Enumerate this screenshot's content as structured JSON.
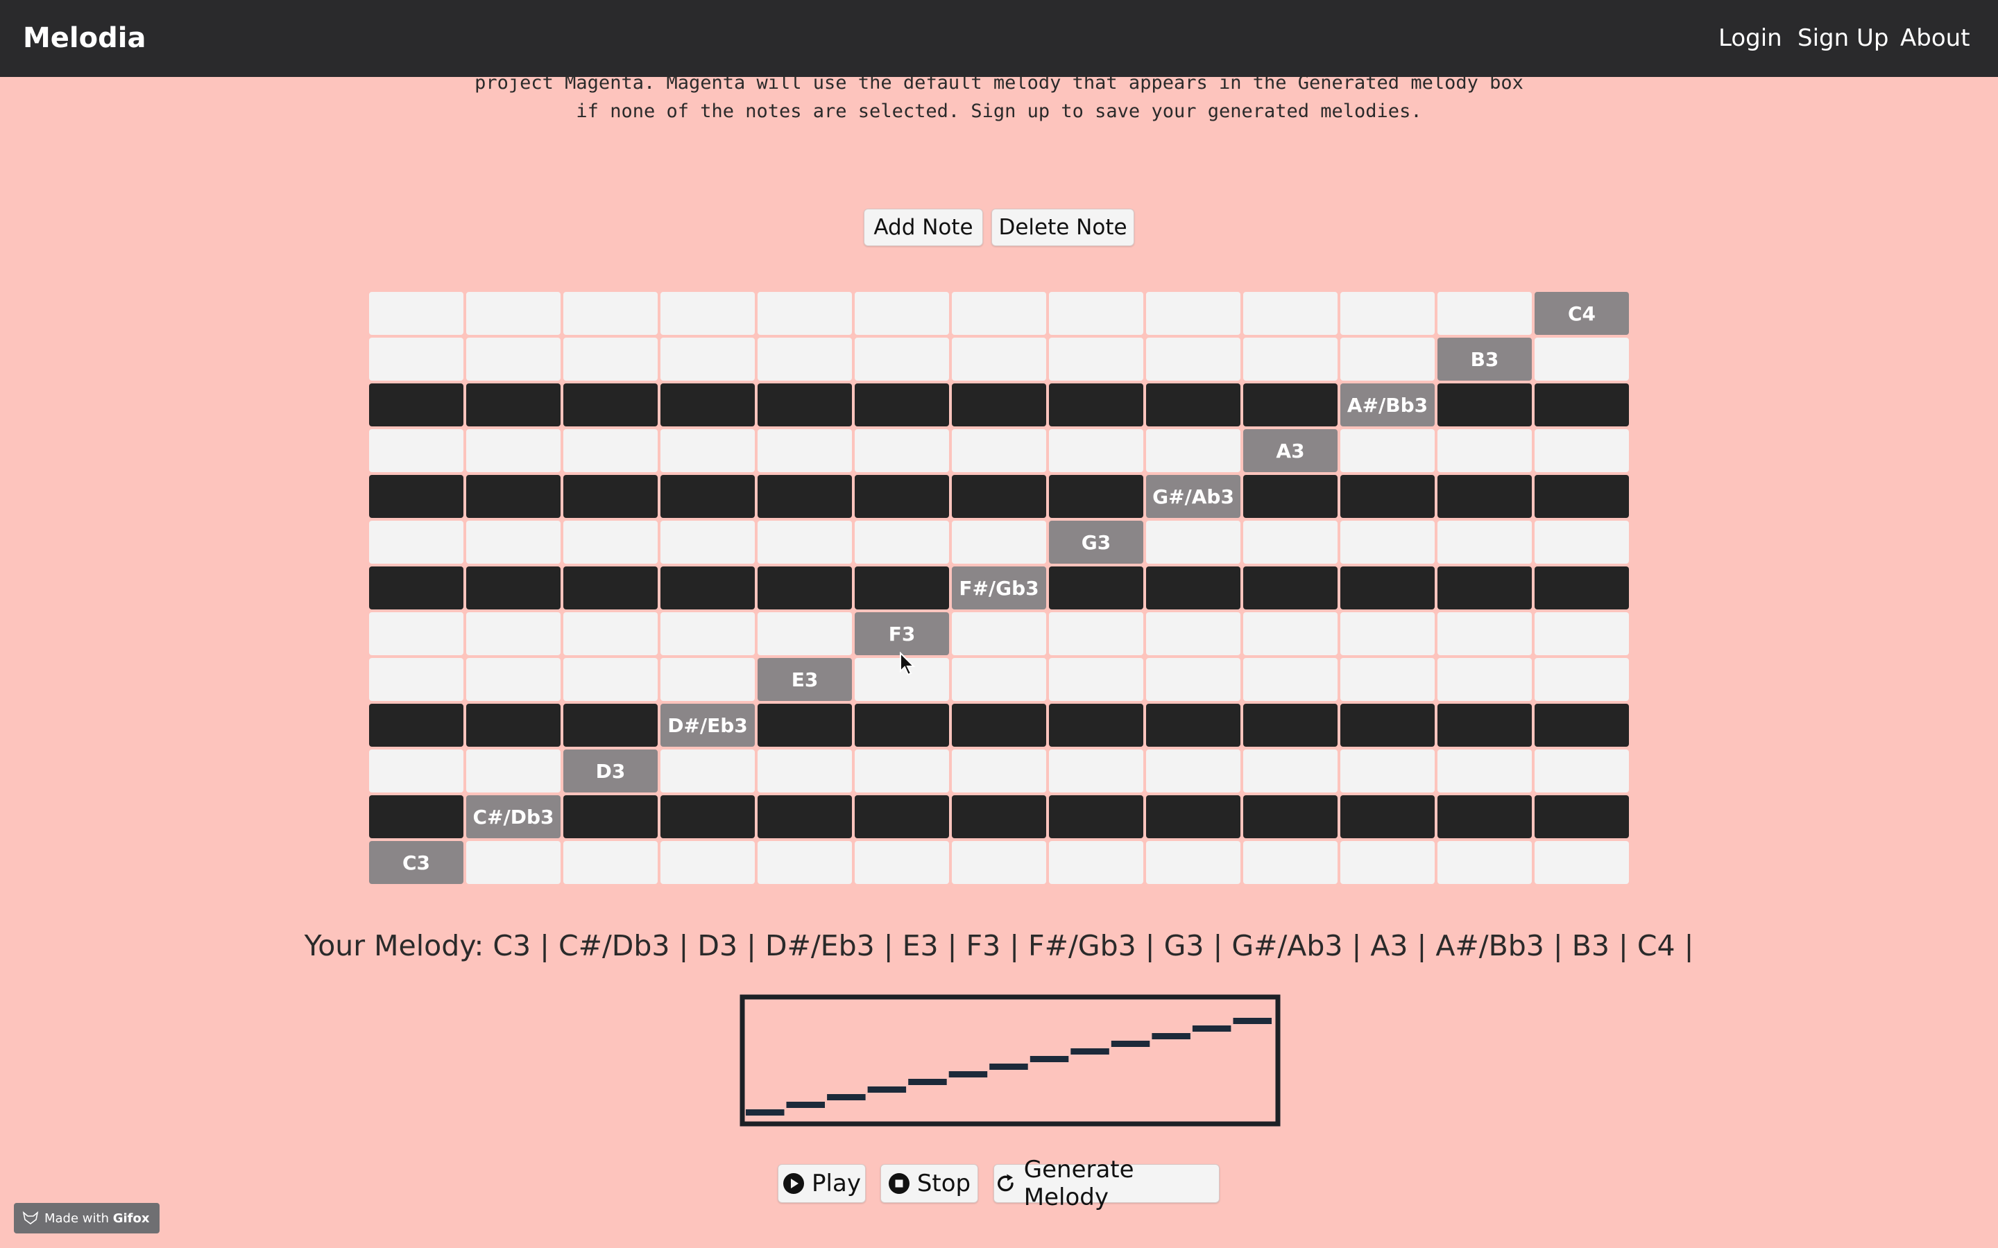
{
  "navbar": {
    "brand": "Melodia",
    "links": [
      "Login",
      "Sign Up",
      "About"
    ]
  },
  "intro": {
    "lines": [
      "project Magenta. Magenta will use the default melody that appears in the Generated melody box",
      "if none of the notes are selected. Sign up to save your generated melodies."
    ]
  },
  "controls": {
    "add_note": "Add Note",
    "delete_note": "Delete Note"
  },
  "grid": {
    "columns": 13,
    "rows": [
      {
        "pitch": "C4",
        "key": "white",
        "selected_column": 13
      },
      {
        "pitch": "B3",
        "key": "white",
        "selected_column": 12
      },
      {
        "pitch": "A#/Bb3",
        "key": "black",
        "selected_column": 11
      },
      {
        "pitch": "A3",
        "key": "white",
        "selected_column": 10
      },
      {
        "pitch": "G#/Ab3",
        "key": "black",
        "selected_column": 9
      },
      {
        "pitch": "G3",
        "key": "white",
        "selected_column": 8
      },
      {
        "pitch": "F#/Gb3",
        "key": "black",
        "selected_column": 7
      },
      {
        "pitch": "F3",
        "key": "white",
        "selected_column": 6
      },
      {
        "pitch": "E3",
        "key": "white",
        "selected_column": 5
      },
      {
        "pitch": "D#/Eb3",
        "key": "black",
        "selected_column": 4
      },
      {
        "pitch": "D3",
        "key": "white",
        "selected_column": 3
      },
      {
        "pitch": "C#/Db3",
        "key": "black",
        "selected_column": 2
      },
      {
        "pitch": "C3",
        "key": "white",
        "selected_column": 1
      }
    ]
  },
  "melody": {
    "label": "Your Melody:",
    "notes": [
      "C3",
      "C#/Db3",
      "D3",
      "D#/Eb3",
      "E3",
      "F3",
      "F#/Gb3",
      "G3",
      "G#/Ab3",
      "A3",
      "A#/Bb3",
      "B3",
      "C4"
    ]
  },
  "playback": {
    "play": "Play",
    "stop": "Stop",
    "generate": "Generate Melody"
  },
  "badge": {
    "prefix": "Made with",
    "brand": "Gifox"
  },
  "colors": {
    "background": "#fdc4bd",
    "navbar": "#2a2a2c",
    "white_key": "#f3f3f3",
    "black_key": "#242424",
    "selected_note": "#8a8688",
    "visualizer_note": "#1c2a3a"
  }
}
